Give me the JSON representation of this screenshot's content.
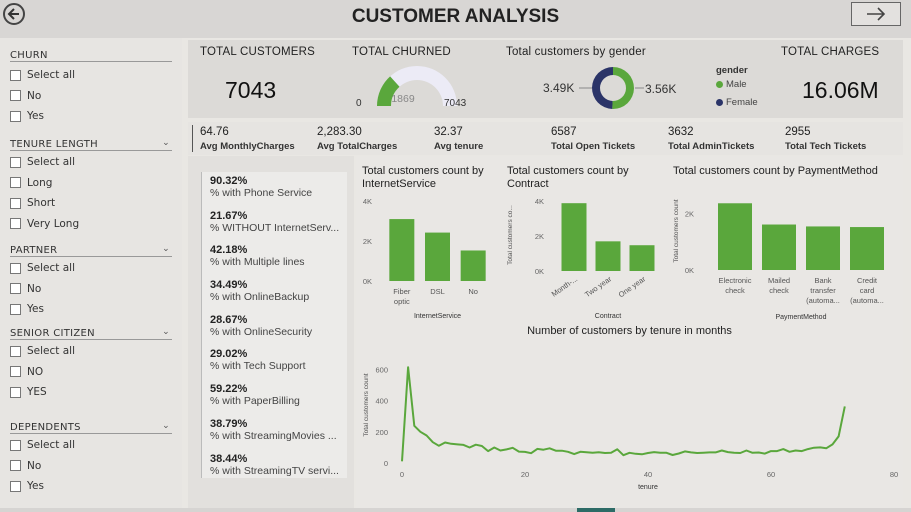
{
  "header": {
    "title": "CUSTOMER ANALYSIS"
  },
  "filters": [
    {
      "title": "CHURN",
      "dropdown": false,
      "options": [
        "Select all",
        "No",
        "Yes"
      ]
    },
    {
      "title": "TENURE LENGTH",
      "dropdown": true,
      "options": [
        "Select all",
        "Long",
        "Short",
        "Very Long"
      ]
    },
    {
      "title": "PARTNER",
      "dropdown": true,
      "options": [
        "Select all",
        "No",
        "Yes"
      ]
    },
    {
      "title": "SENIOR CITIZEN",
      "dropdown": true,
      "options": [
        "Select all",
        "NO",
        "YES"
      ]
    },
    {
      "title": "DEPENDENTS",
      "dropdown": true,
      "options": [
        "Select all",
        "No",
        "Yes"
      ]
    }
  ],
  "kpis": {
    "total_customers": {
      "label": "TOTAL CUSTOMERS",
      "value": "7043"
    },
    "total_churned": {
      "label": "TOTAL CHURNED",
      "gauge_value": 1869,
      "gauge_min": "0",
      "gauge_max": "7043",
      "gauge_text": "1869"
    },
    "gender": {
      "label": "Total customers by gender",
      "left_value": "3.49K",
      "right_value": "3.56K",
      "legend_title": "gender",
      "legend_items": [
        "Male",
        "Female"
      ],
      "colors": {
        "Male": "#5aa73c",
        "Female": "#2b3468"
      },
      "female_share": 0.495
    },
    "total_charges": {
      "label": "TOTAL CHARGES",
      "value": "16.06M"
    }
  },
  "metrics": [
    {
      "value": "64.76",
      "label": "Avg MonthlyCharges"
    },
    {
      "value": "2,283.30",
      "label": "Avg TotalCharges"
    },
    {
      "value": "32.37",
      "label": "Avg tenure"
    },
    {
      "value": "6587",
      "label": "Total Open Tickets"
    },
    {
      "value": "3632",
      "label": "Total AdminTickets"
    },
    {
      "value": "2955",
      "label": "Total Tech Tickets"
    }
  ],
  "percentages": [
    {
      "value": "90.32%",
      "label": "% with Phone Service"
    },
    {
      "value": "21.67%",
      "label": "% WITHOUT InternetServ..."
    },
    {
      "value": "42.18%",
      "label": "% with Multiple lines"
    },
    {
      "value": "34.49%",
      "label": "% with OnlineBackup"
    },
    {
      "value": "28.67%",
      "label": "% with OnlineSecurity"
    },
    {
      "value": "29.02%",
      "label": "% with Tech Support"
    },
    {
      "value": "59.22%",
      "label": "% with PaperBilling"
    },
    {
      "value": "38.79%",
      "label": "% with StreamingMovies ..."
    },
    {
      "value": "38.44%",
      "label": "% with StreamingTV servi..."
    }
  ],
  "colors": {
    "bar": "#5aa73c",
    "line": "#5aa73c"
  },
  "chart_data": [
    {
      "type": "bar",
      "title": "Total customers count by InternetService",
      "xlabel": "InternetService",
      "ylabel": "",
      "categories": [
        "Fiber optic",
        "DSL",
        "No"
      ],
      "values": [
        3096,
        2421,
        1526
      ],
      "yticks": [
        "0K",
        "2K",
        "4K"
      ],
      "ylim": [
        0,
        4000
      ]
    },
    {
      "type": "bar",
      "title": "Total customers count by Contract",
      "xlabel": "Contract",
      "ylabel": "Total customers co...",
      "categories": [
        "Month-...",
        "Two year",
        "One year"
      ],
      "values": [
        3875,
        1695,
        1473
      ],
      "yticks": [
        "0K",
        "2K",
        "4K"
      ],
      "ylim": [
        0,
        4000
      ]
    },
    {
      "type": "bar",
      "title": "Total customers count by PaymentMethod",
      "xlabel": "PaymentMethod",
      "ylabel": "Total customers count",
      "categories": [
        "Electronic check",
        "Mailed check",
        "Bank transfer (automa...",
        "Credit card (automa..."
      ],
      "values": [
        2365,
        1612,
        1544,
        1522
      ],
      "yticks": [
        "0K",
        "2K"
      ],
      "ylim": [
        0,
        2800
      ]
    },
    {
      "type": "line",
      "title": "Number of customers by tenure in months",
      "xlabel": "tenure",
      "ylabel": "Total customers count",
      "xticks": [
        "0",
        "20",
        "40",
        "60",
        "80"
      ],
      "yticks": [
        "0",
        "200",
        "400",
        "600"
      ],
      "xlim": [
        0,
        80
      ],
      "ylim": [
        0,
        640
      ],
      "x": [
        0,
        1,
        2,
        3,
        4,
        5,
        6,
        7,
        8,
        9,
        10,
        11,
        12,
        13,
        14,
        15,
        16,
        17,
        18,
        19,
        20,
        21,
        22,
        23,
        24,
        25,
        26,
        27,
        28,
        29,
        30,
        31,
        32,
        33,
        34,
        35,
        36,
        37,
        38,
        39,
        40,
        41,
        42,
        43,
        44,
        45,
        46,
        47,
        48,
        49,
        50,
        51,
        52,
        53,
        54,
        55,
        56,
        57,
        58,
        59,
        60,
        61,
        62,
        63,
        64,
        65,
        66,
        67,
        68,
        69,
        70,
        71,
        72
      ],
      "y": [
        11,
        613,
        238,
        200,
        176,
        133,
        110,
        131,
        123,
        119,
        116,
        99,
        117,
        109,
        76,
        99,
        80,
        87,
        97,
        73,
        71,
        63,
        90,
        85,
        94,
        79,
        79,
        72,
        57,
        72,
        69,
        65,
        69,
        64,
        65,
        88,
        50,
        65,
        59,
        56,
        64,
        70,
        65,
        65,
        51,
        61,
        74,
        68,
        64,
        66,
        68,
        68,
        80,
        70,
        65,
        64,
        80,
        65,
        67,
        60,
        76,
        76,
        89,
        72,
        80,
        76,
        89,
        98,
        100,
        95,
        119,
        170,
        362
      ]
    }
  ]
}
